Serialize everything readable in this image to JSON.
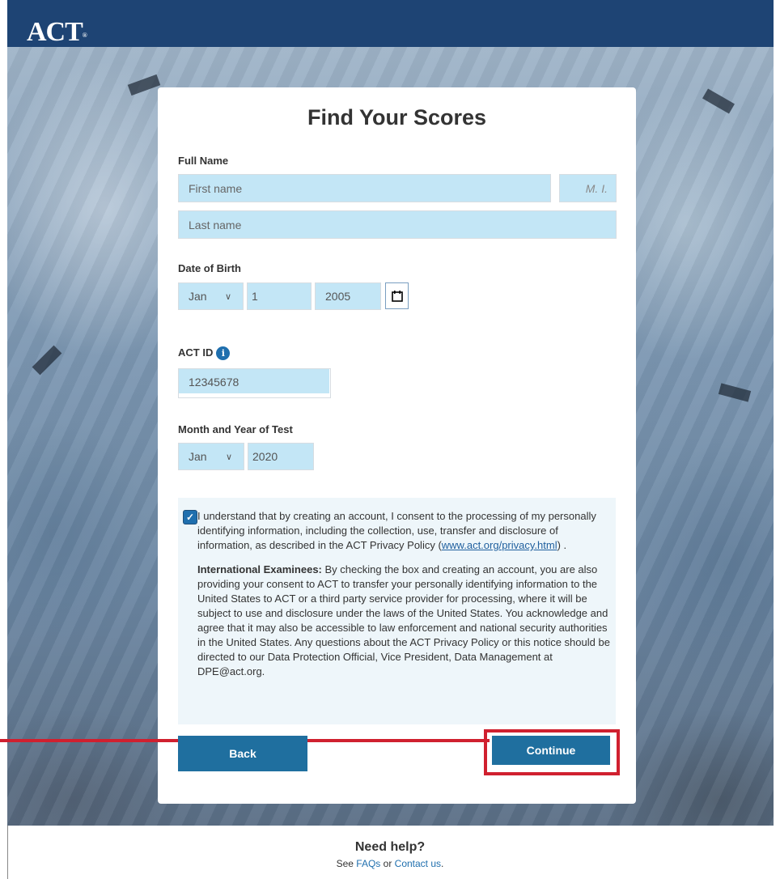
{
  "header": {
    "logo_text": "ACT",
    "logo_mark": "®",
    "brand_color": "#1e4474"
  },
  "form": {
    "title": "Find Your Scores",
    "full_name": {
      "label": "Full Name",
      "first_name_placeholder": "First name",
      "middle_initial_placeholder": "M. I.",
      "last_name_placeholder": "Last name"
    },
    "dob": {
      "label": "Date of Birth",
      "month": "Jan",
      "day": "1",
      "year": "2005",
      "calendar_icon": "calendar-icon"
    },
    "act_id": {
      "label": "ACT ID",
      "info_icon_glyph": "i",
      "value": "12345678"
    },
    "test_date": {
      "label": "Month and Year of Test",
      "month": "Jan",
      "year": "2020"
    },
    "consent": {
      "checked": true,
      "checkmark": "✓",
      "text_before_link": "I understand that by creating an account, I consent to the processing of my personally identifying information, including the collection, use, transfer and disclosure of information, as described in the ACT Privacy Policy (",
      "link_text": "www.act.org/privacy.html",
      "text_after_link": ") .",
      "intl_heading": "International Examinees:",
      "intl_text": " By checking the box and creating an account, you are also providing your consent to ACT to transfer your personally identifying information to the United States to ACT or a third party service provider for processing, where it will be subject to use and disclosure under the laws of the United States. You acknowledge and agree that it may also be accessible to law enforcement and national security authorities in the United States. Any questions about the ACT Privacy Policy or this notice should be directed to our Data Protection Official, Vice President, Data Management at DPE@act.org."
    },
    "back_label": "Back",
    "continue_label": "Continue",
    "button_color": "#1f6f9f",
    "highlight_color": "#d0202f"
  },
  "footer": {
    "help_title": "Need help?",
    "see_text": "See ",
    "faqs_link": "FAQs",
    "or_text": " or ",
    "contact_link": "Contact us",
    "end_text": "."
  }
}
